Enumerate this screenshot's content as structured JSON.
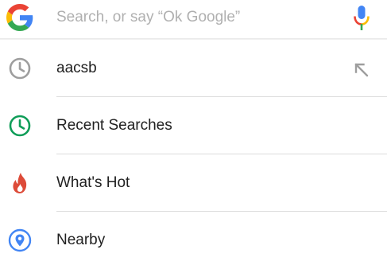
{
  "search": {
    "placeholder": "Search, or say “Ok Google”",
    "value": ""
  },
  "suggestions": [
    {
      "label": "aacsb",
      "icon": "history-clock-icon",
      "kind": "history"
    },
    {
      "label": "Recent Searches",
      "icon": "clock-icon",
      "kind": "category"
    },
    {
      "label": "What's Hot",
      "icon": "flame-icon",
      "kind": "category"
    },
    {
      "label": "Nearby",
      "icon": "location-pin-icon",
      "kind": "category"
    }
  ],
  "colors": {
    "google_blue": "#4285F4",
    "google_red": "#EA4335",
    "google_yellow": "#FBBC05",
    "google_green": "#34A853",
    "history_gray": "#9e9e9e",
    "recent_green": "#0f9d58",
    "hot_red": "#dd4b39",
    "nearby_blue": "#4285f4"
  }
}
